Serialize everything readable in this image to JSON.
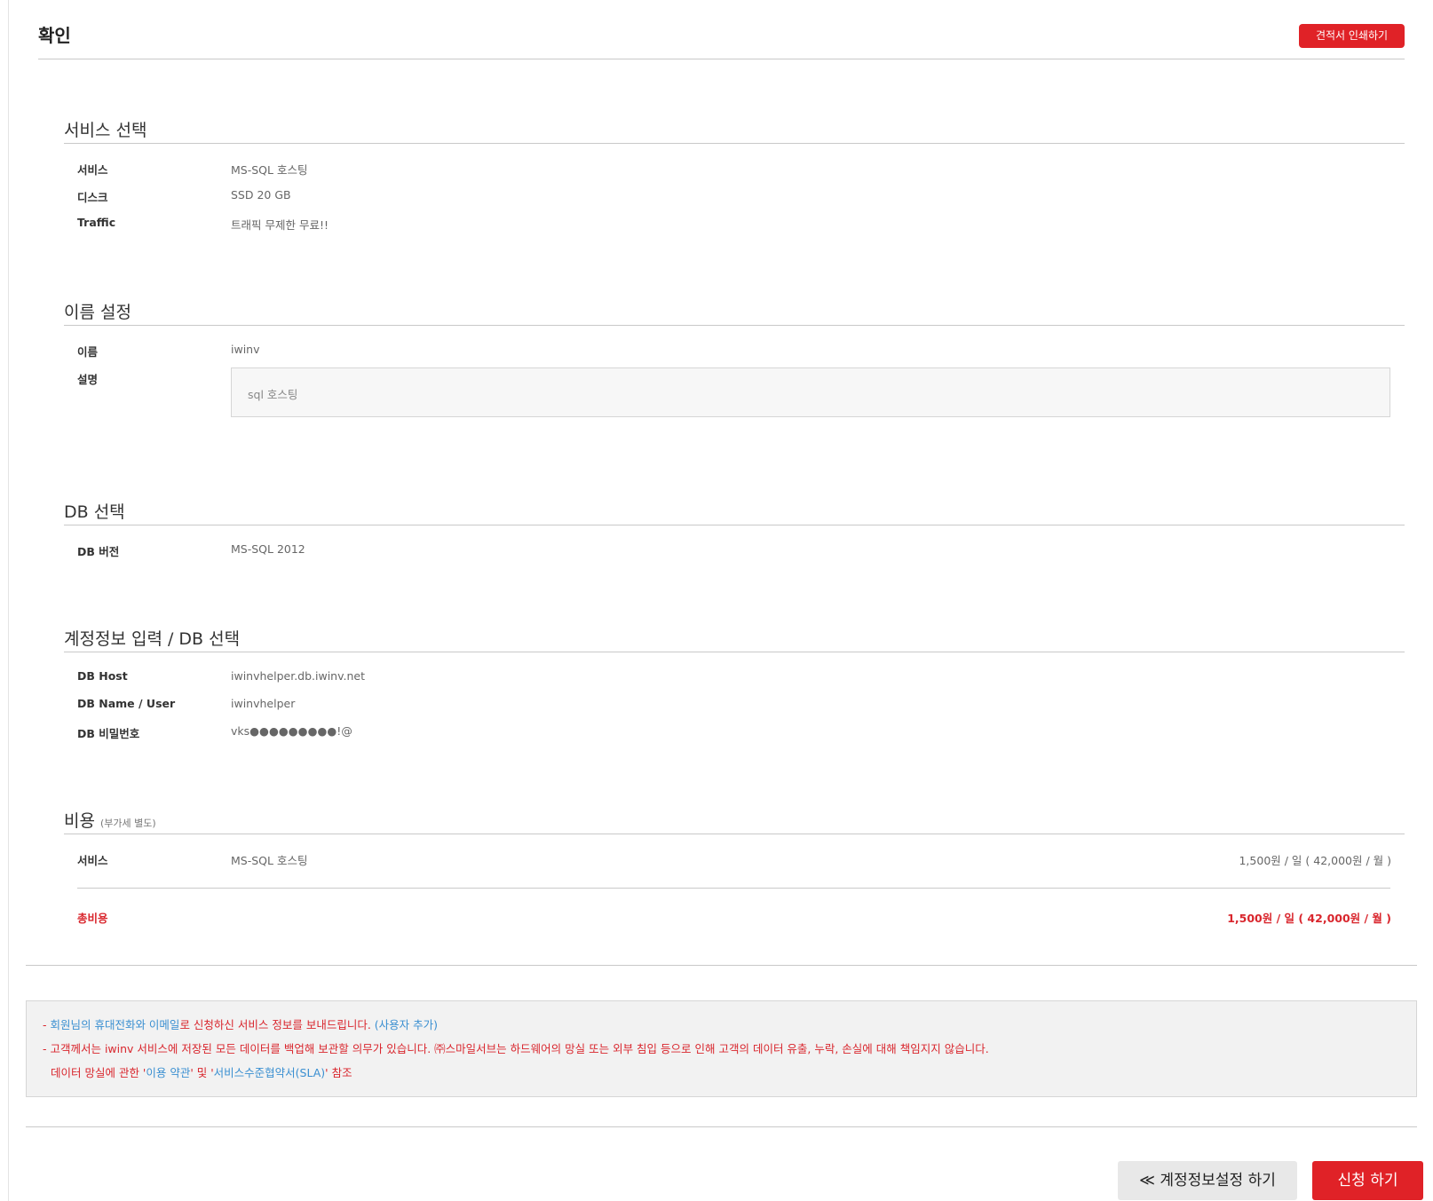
{
  "header": {
    "title": "확인",
    "print_button": "견적서 인쇄하기"
  },
  "service": {
    "title": "서비스 선택",
    "rows": [
      {
        "label": "서비스",
        "value": "MS-SQL 호스팅"
      },
      {
        "label": "디스크",
        "value": "SSD 20 GB"
      },
      {
        "label": "Traffic",
        "value": "트래픽 무제한 무료!!"
      }
    ]
  },
  "name_setting": {
    "title": "이름 설정",
    "name_label": "이름",
    "name_value": "iwinv",
    "desc_label": "설명",
    "desc_value": "sql 호스팅"
  },
  "db": {
    "title": "DB 선택",
    "rows": [
      {
        "label": "DB 버전",
        "value": "MS-SQL 2012"
      }
    ]
  },
  "account": {
    "title": "계정정보 입력 / DB 선택",
    "rows": [
      {
        "label": "DB Host",
        "value": "iwinvhelper.db.iwinv.net"
      },
      {
        "label": "DB Name / User",
        "value": "iwinvhelper"
      },
      {
        "label": "DB 비밀번호",
        "value": "vks●●●●●●●●●!@"
      }
    ]
  },
  "cost": {
    "title": "비용",
    "subtitle": "(부가세 별도)",
    "service_label": "서비스",
    "service_value": "MS-SQL 호스팅",
    "service_price": "1,500원 / 일 ( 42,000원 / 월 )",
    "total_label": "총비용",
    "total_price": "1,500원 / 일 ( 42,000원 / 월 )"
  },
  "notice": {
    "line1": {
      "dash": "- ",
      "phone_email": "회원님의 휴대전화와 이메일",
      "text": "로 신청하신 서비스 정보를 보내드립니다. ",
      "add_user": "(사용자 추가)"
    },
    "line2": "- 고객께서는 iwinv 서비스에 저장된 모든 데이터를 백업해 보관할 의무가 있습니다. ㈜스마일서브는 하드웨어의 망실 또는 외부 침입 등으로 인해 고객의 데이터 유출, 누락, 손실에 대해 책임지지 않습니다.",
    "line3": {
      "prefix": "데이터 망실에 관한 '",
      "terms": "이용 약관",
      "mid": "' 및 '",
      "sla": "서비스수준협약서(SLA)",
      "suffix": "' 참조"
    }
  },
  "buttons": {
    "prev": "≪ 계정정보설정 하기",
    "submit": "신청 하기"
  },
  "colors": {
    "accent": "#e02227",
    "link": "#3a8fd1"
  }
}
